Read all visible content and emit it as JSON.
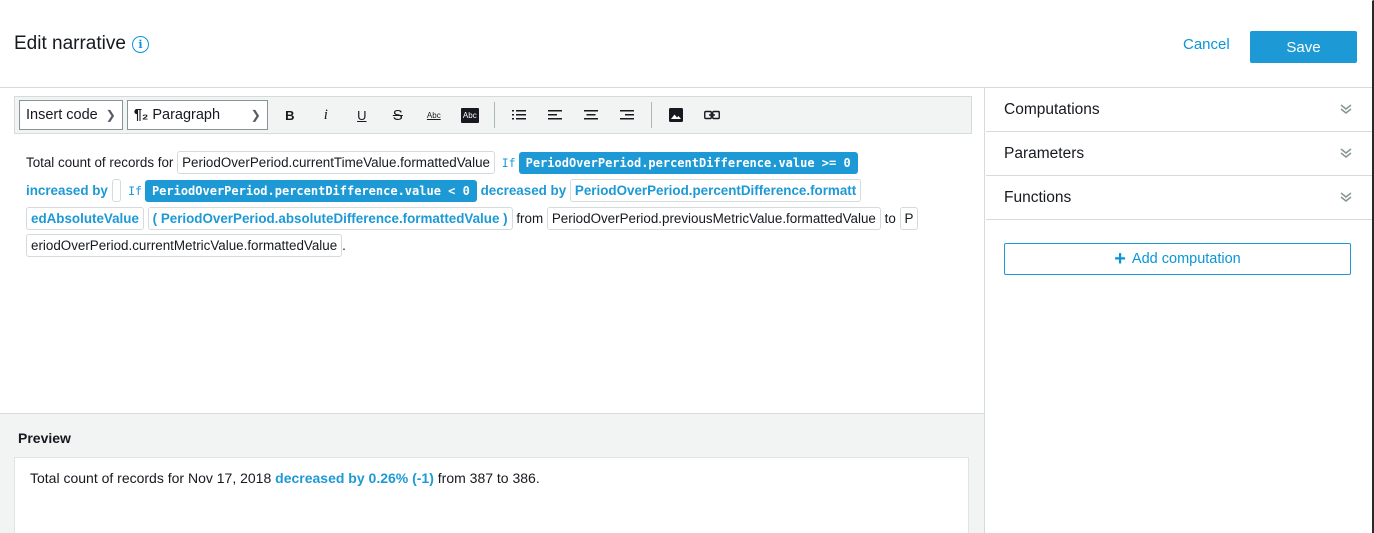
{
  "header": {
    "title": "Edit narrative",
    "info_icon": "i",
    "cancel_label": "Cancel",
    "save_label": "Save"
  },
  "toolbar": {
    "insert_code_label": "Insert code",
    "paragraph_label": "Paragraph",
    "paragraph_icon": "¶₂",
    "bold": "B",
    "italic": "i",
    "underline": "U",
    "strikethrough": "S",
    "text_color": "Abc",
    "highlight": "Abc",
    "icons": [
      "chevron-down-icon",
      "bold-icon",
      "italic-icon",
      "underline-icon",
      "strikethrough-icon",
      "text-color-icon",
      "highlight-icon",
      "bulleted-list-icon",
      "align-left-icon",
      "align-center-icon",
      "align-right-icon",
      "image-icon",
      "link-icon"
    ]
  },
  "narrative": {
    "text1": "Total count of records for",
    "chip_current_time": "PeriodOverPeriod.currentTimeValue.formattedValue",
    "if1": "If",
    "cond1": "PeriodOverPeriod.percentDifference.value >= 0",
    "increased_by": "increased by",
    "if2": "If",
    "cond2": "PeriodOverPeriod.percentDifference.value < 0",
    "decreased_by": "decreased by",
    "chip_pct_line1": "PeriodOverPeriod.percentDifference.formatt",
    "chip_pct_line2": "edAbsoluteValue",
    "chip_abs_diff": "( PeriodOverPeriod.absoluteDifference.formattedValue )",
    "from": "from",
    "chip_previous": "PeriodOverPeriod.previousMetricValue.formattedValue",
    "to": "to",
    "chip_current_line1": "P",
    "chip_current_line2": "eriodOverPeriod.currentMetricValue.formattedValue",
    "period": "."
  },
  "preview": {
    "title": "Preview",
    "text1": "Total count of records for Nov 17, 2018",
    "highlight": "decreased by 0.26% (-1)",
    "text2": "from 387 to 386."
  },
  "side_panel": {
    "sections": [
      {
        "label": "Computations"
      },
      {
        "label": "Parameters"
      },
      {
        "label": "Functions"
      }
    ],
    "add_computation_label": "Add computation"
  },
  "colors": {
    "accent": "#1d99d6",
    "link": "#0a96d6",
    "text": "#16191f",
    "border": "#d5dbdb",
    "panel_bg": "#f2f3f3"
  }
}
